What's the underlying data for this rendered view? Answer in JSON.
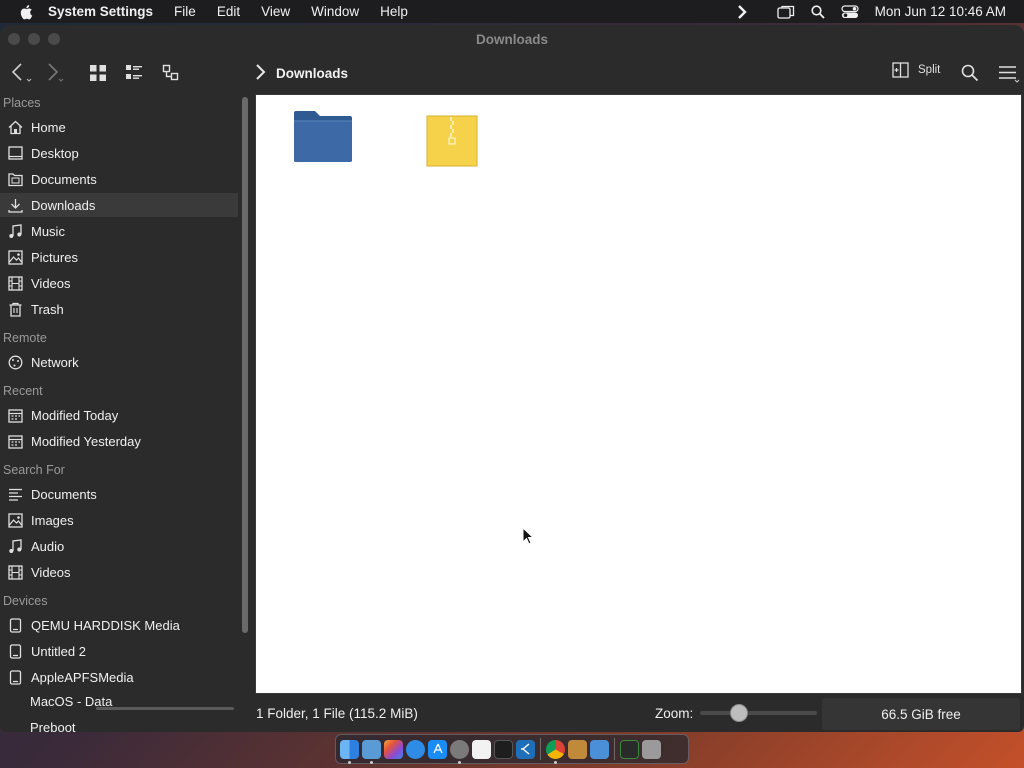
{
  "menubar": {
    "app_name": "System Settings",
    "menus": [
      "File",
      "Edit",
      "View",
      "Window",
      "Help"
    ],
    "clock": "Mon Jun 12  10:46 AM"
  },
  "window": {
    "title": "Downloads",
    "breadcrumb": "Downloads",
    "split_label": "Split"
  },
  "sidebar": {
    "places_heading": "Places",
    "places": [
      {
        "label": "Home",
        "icon": "home-icon"
      },
      {
        "label": "Desktop",
        "icon": "desktop-icon"
      },
      {
        "label": "Documents",
        "icon": "documents-icon"
      },
      {
        "label": "Downloads",
        "icon": "downloads-icon"
      },
      {
        "label": "Music",
        "icon": "music-icon"
      },
      {
        "label": "Pictures",
        "icon": "pictures-icon"
      },
      {
        "label": "Videos",
        "icon": "videos-icon"
      },
      {
        "label": "Trash",
        "icon": "trash-icon"
      }
    ],
    "remote_heading": "Remote",
    "remote": [
      {
        "label": "Network",
        "icon": "network-icon"
      }
    ],
    "recent_heading": "Recent",
    "recent": [
      {
        "label": "Modified Today",
        "icon": "calendar-icon"
      },
      {
        "label": "Modified Yesterday",
        "icon": "calendar-icon"
      }
    ],
    "search_heading": "Search For",
    "search": [
      {
        "label": "Documents",
        "icon": "text-lines-icon"
      },
      {
        "label": "Images",
        "icon": "image-icon"
      },
      {
        "label": "Audio",
        "icon": "music-note-icon"
      },
      {
        "label": "Videos",
        "icon": "film-icon"
      }
    ],
    "devices_heading": "Devices",
    "devices": [
      {
        "label": "QEMU HARDDISK Media",
        "icon": "drive-icon"
      },
      {
        "label": "Untitled 2",
        "icon": "drive-icon"
      },
      {
        "label": "AppleAPFSMedia",
        "icon": "drive-icon"
      },
      {
        "label": "MacOS - Data",
        "icon": ""
      },
      {
        "label": "Preboot",
        "icon": ""
      }
    ]
  },
  "files": [
    {
      "type": "folder",
      "color": "#3d6aa6"
    },
    {
      "type": "archive",
      "color": "#f5d24a"
    }
  ],
  "statusbar": {
    "summary": "1 Folder, 1 File (115.2 MiB)",
    "zoom_label": "Zoom:",
    "zoom_level": 0.3,
    "free_space": "66.5 GiB free"
  },
  "dock": {
    "apps": [
      "finder-icon",
      "files-icon",
      "launchpad-icon",
      "safari-icon",
      "app-store-icon",
      "system-settings-icon",
      "textedit-icon",
      "terminal-icon",
      "vscode-icon",
      "chrome-icon",
      "tools-icon",
      "folder-icon",
      "activity-monitor-icon",
      "trash-icon"
    ]
  },
  "colors": {
    "accent_folder": "#3d6aa6",
    "archive": "#f5d24a",
    "window_bg": "#2b2b2b"
  }
}
